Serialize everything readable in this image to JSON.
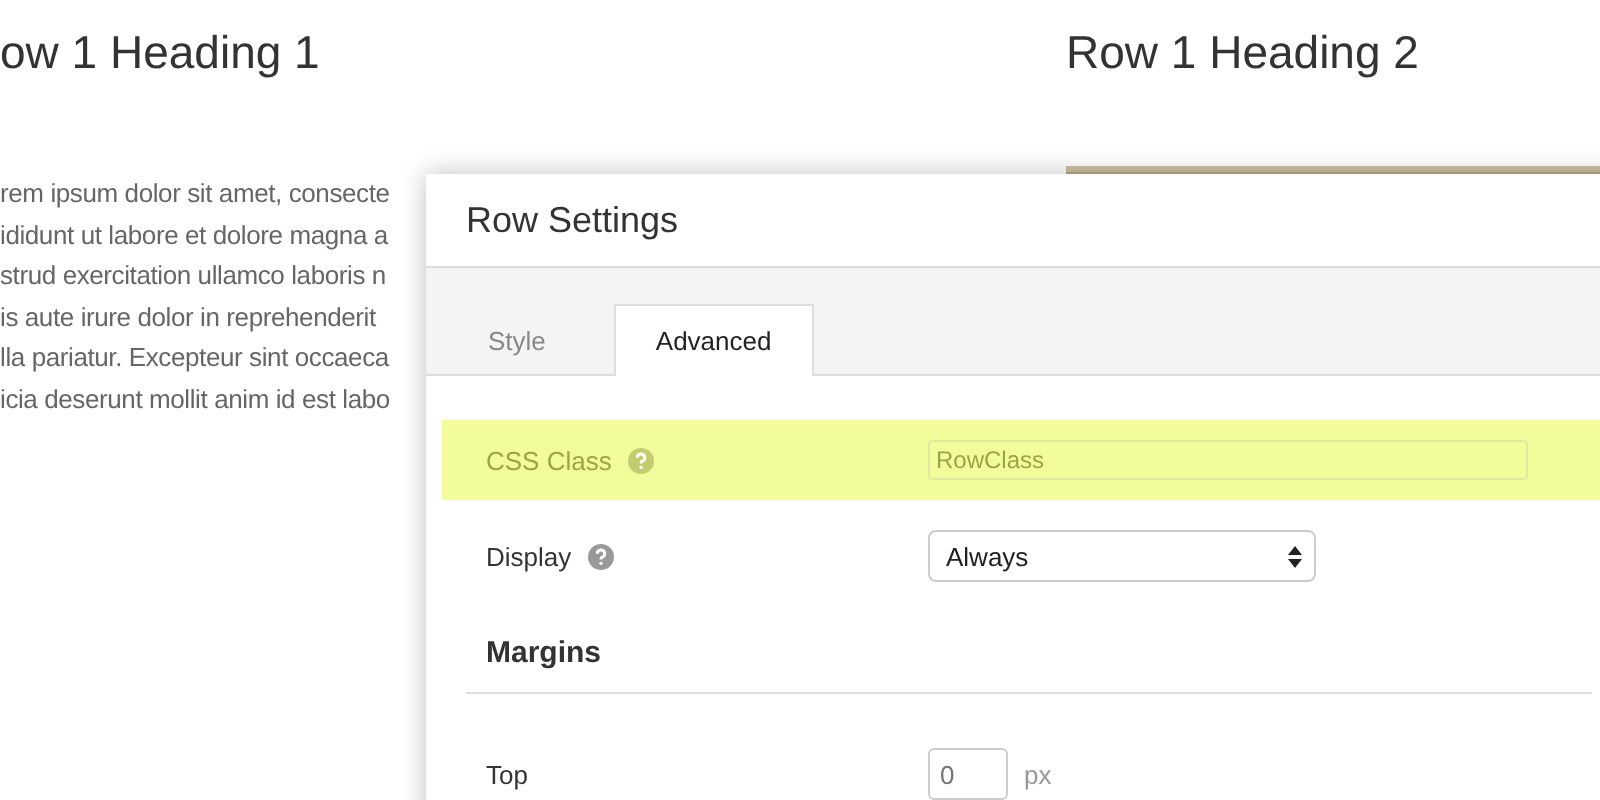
{
  "page": {
    "columns": [
      {
        "heading": "ow 1 Heading 1",
        "paragraph_lines": [
          "rem ipsum dolor sit amet, consecte",
          "ididunt ut labore et dolore magna a",
          "strud exercitation ullamco laboris n",
          "is aute irure dolor in reprehenderit",
          "lla pariatur. Excepteur sint occaeca",
          "icia deserunt mollit anim id est labo"
        ]
      },
      {
        "heading": "Row 1 Heading 2"
      }
    ]
  },
  "dialog": {
    "title": "Row Settings",
    "tabs": [
      {
        "label": "Style",
        "selected": false
      },
      {
        "label": "Advanced",
        "selected": true
      }
    ],
    "fields": [
      {
        "kind": "text",
        "label": "CSS Class",
        "help": true,
        "highlighted": true,
        "value": "RowClass"
      },
      {
        "kind": "select",
        "label": "Display",
        "help": true,
        "highlighted": false,
        "value": "Always"
      },
      {
        "kind": "section",
        "label": "Margins"
      },
      {
        "kind": "number",
        "label": "Top",
        "help": false,
        "highlighted": false,
        "placeholder": "0",
        "unit": "px"
      }
    ]
  }
}
